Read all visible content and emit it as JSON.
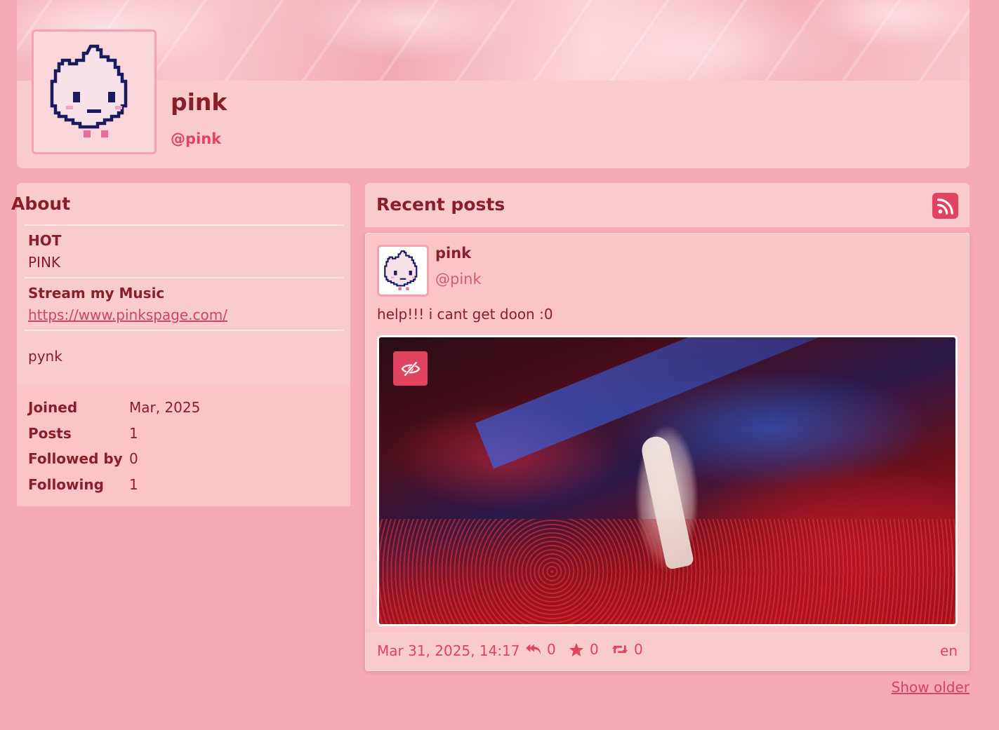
{
  "profile": {
    "display_name": "pink",
    "handle": "@pink"
  },
  "about": {
    "title": "About",
    "fields": [
      {
        "name": "HOT",
        "value": "PINK"
      },
      {
        "name": "Stream my Music",
        "value": "https://www.pinkspage.com/"
      }
    ],
    "bio": "pynk",
    "stats": [
      {
        "label": "Joined",
        "value": "Mar, 2025"
      },
      {
        "label": "Posts",
        "value": "1"
      },
      {
        "label": "Followed by",
        "value": "0"
      },
      {
        "label": "Following",
        "value": "1"
      }
    ]
  },
  "posts_section": {
    "title": "Recent posts",
    "rss_icon": "rss-icon"
  },
  "post": {
    "author_name": "pink",
    "author_handle": "@pink",
    "text": "help!!! i cant get doon :0",
    "date": "Mar 31, 2025, 14:17",
    "replies": "0",
    "favourites": "0",
    "boosts": "0",
    "language": "en",
    "hide_media_icon": "eye-slash-icon"
  },
  "pagination": {
    "show_older": "Show older"
  },
  "colors": {
    "background": "#f6a9b7",
    "card": "#f9cbcd",
    "accent": "#e0445e",
    "text": "#8a1f2a"
  }
}
